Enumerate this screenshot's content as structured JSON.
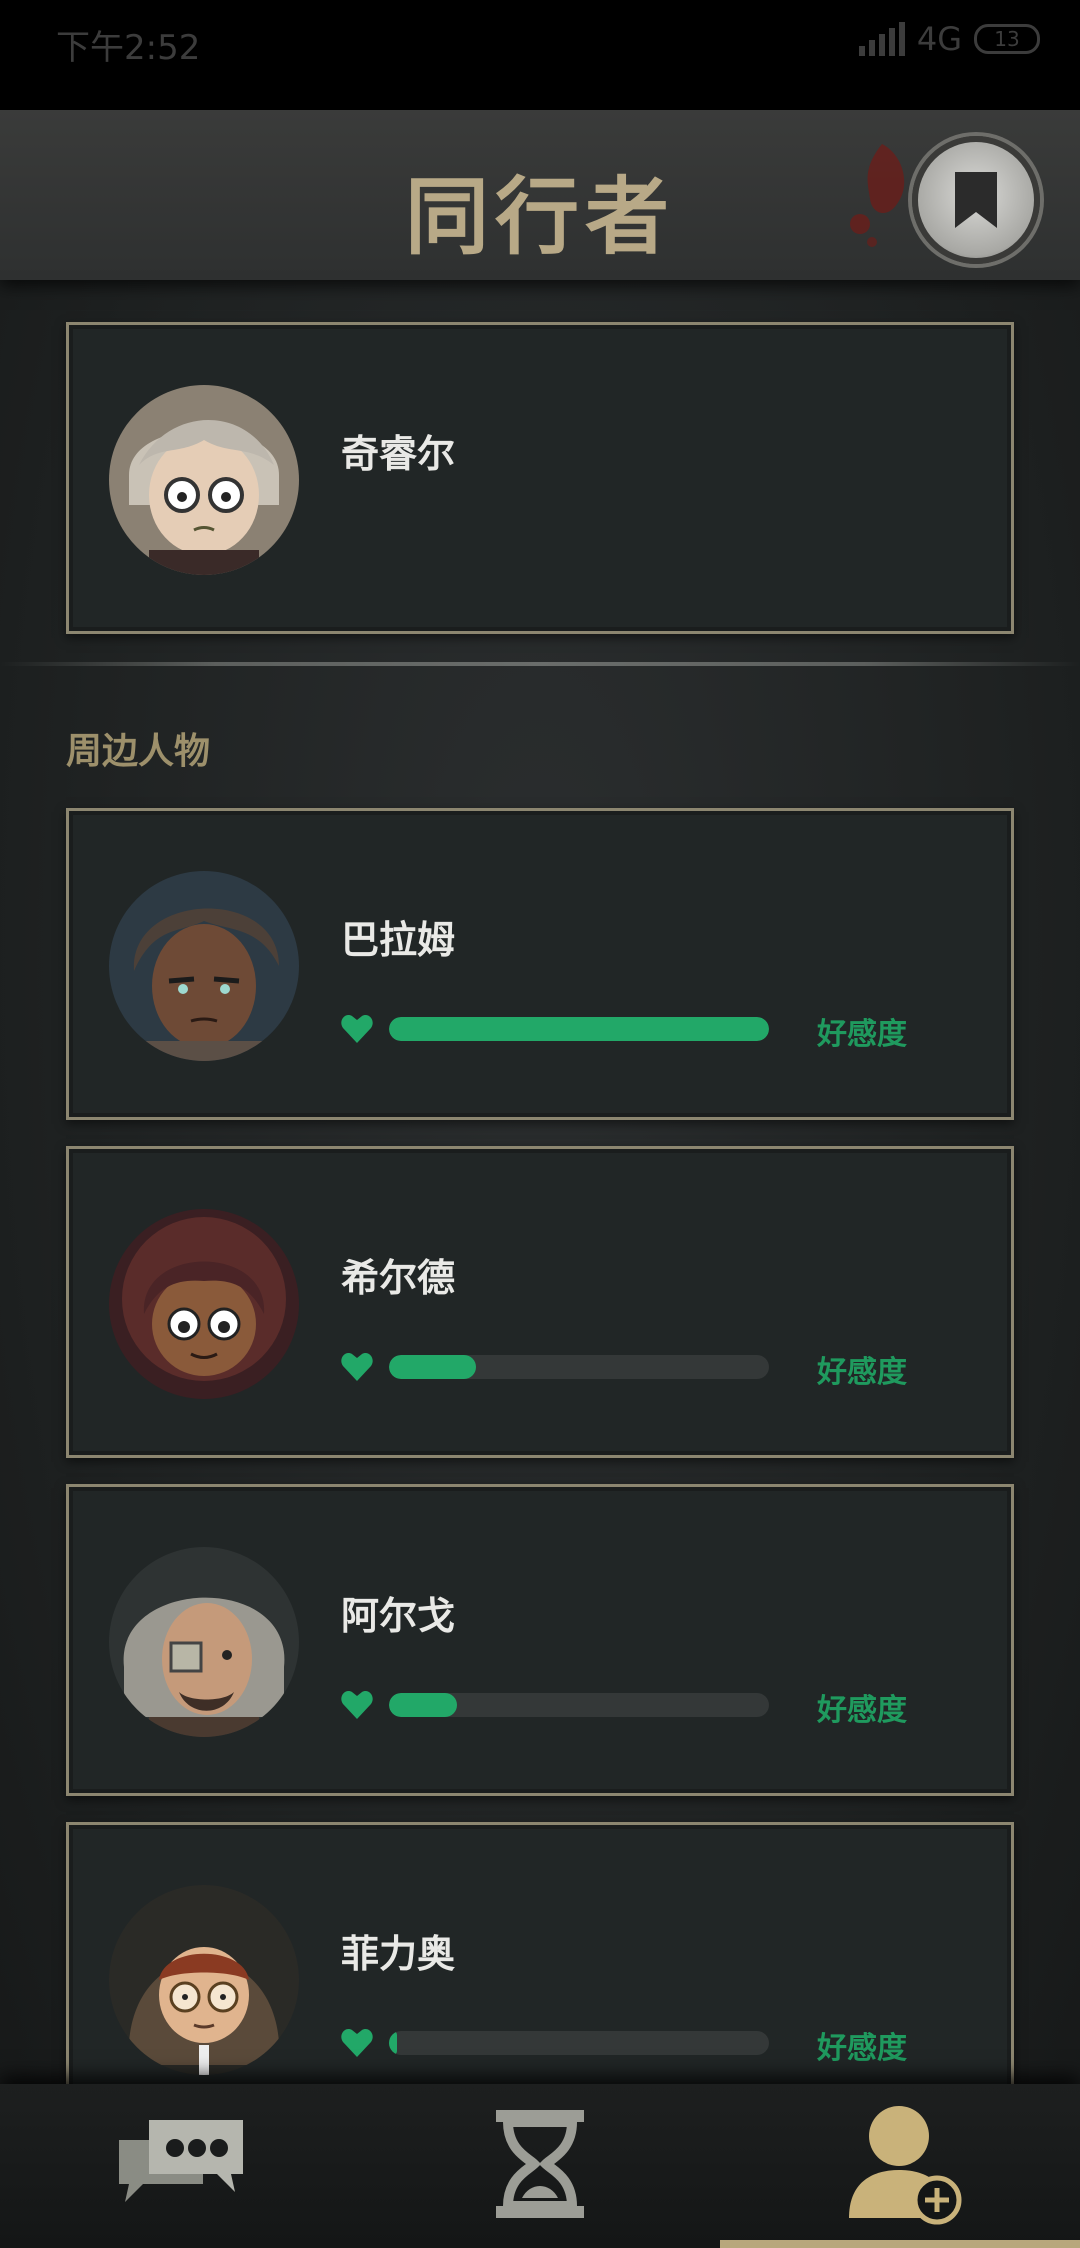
{
  "status_bar": {
    "time": "下午2:52",
    "network": "4G",
    "battery": "13"
  },
  "header": {
    "title": "同行者"
  },
  "companion": {
    "name": "奇睿尔"
  },
  "section_label": "周边人物",
  "characters": [
    {
      "name": "巴拉姆",
      "affinity_label": "好感度",
      "affinity_level": 1.0
    },
    {
      "name": "希尔德",
      "affinity_label": "好感度",
      "affinity_level": 0.23
    },
    {
      "name": "阿尔戈",
      "affinity_label": "好感度",
      "affinity_level": 0.18
    },
    {
      "name": "菲力奥",
      "affinity_label": "好感度",
      "affinity_level": 0.02
    }
  ],
  "bottom_nav": {
    "items": [
      {
        "icon": "chat-bubbles-icon",
        "active": false
      },
      {
        "icon": "hourglass-icon",
        "active": false
      },
      {
        "icon": "person-add-icon",
        "active": true
      }
    ]
  },
  "colors": {
    "accent_gold": "#b8a987",
    "affinity_green": "#22a868",
    "card_border": "#8c8670"
  }
}
